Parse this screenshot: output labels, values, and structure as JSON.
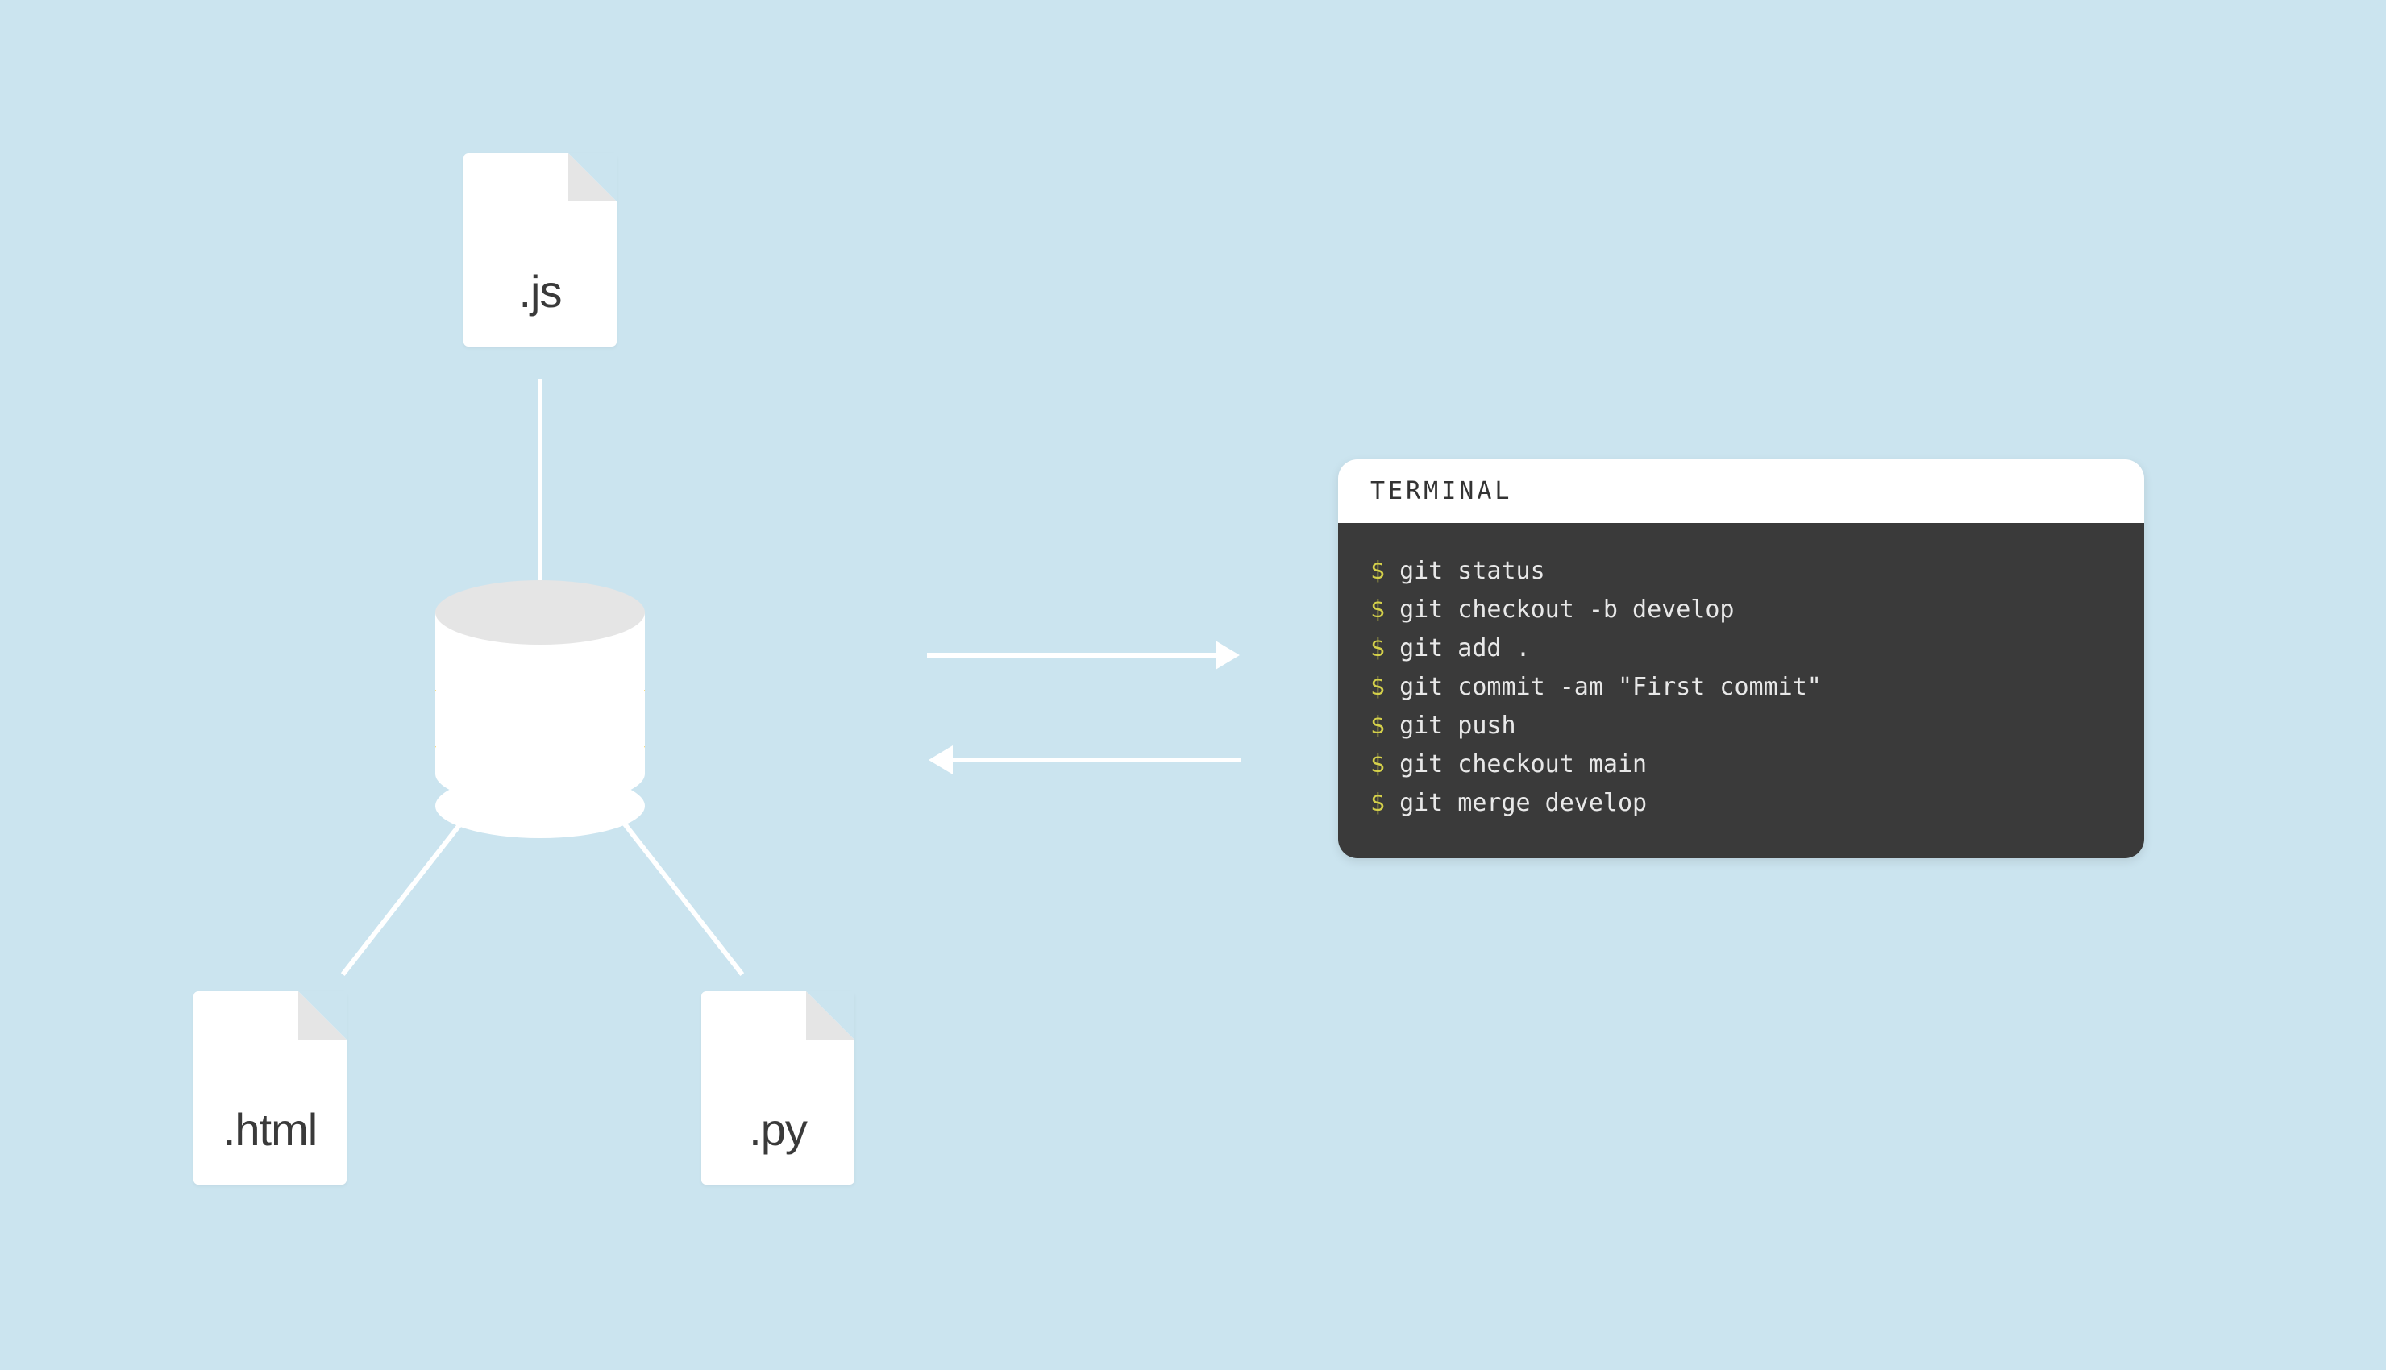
{
  "files": {
    "top": {
      "ext": ".js"
    },
    "bottom_left": {
      "ext": ".html"
    },
    "bottom_right": {
      "ext": ".py"
    }
  },
  "terminal": {
    "title": "TERMINAL",
    "prompt": "$",
    "commands": [
      "git status",
      "git checkout -b develop",
      "git add .",
      "git commit -am \"First commit\"",
      "git push",
      "git checkout main",
      "git merge develop"
    ]
  },
  "colors": {
    "background": "#cbe4ef",
    "accent": "#f5b800",
    "terminal_bg": "#3a3a3a",
    "prompt": "#d4d04a"
  }
}
